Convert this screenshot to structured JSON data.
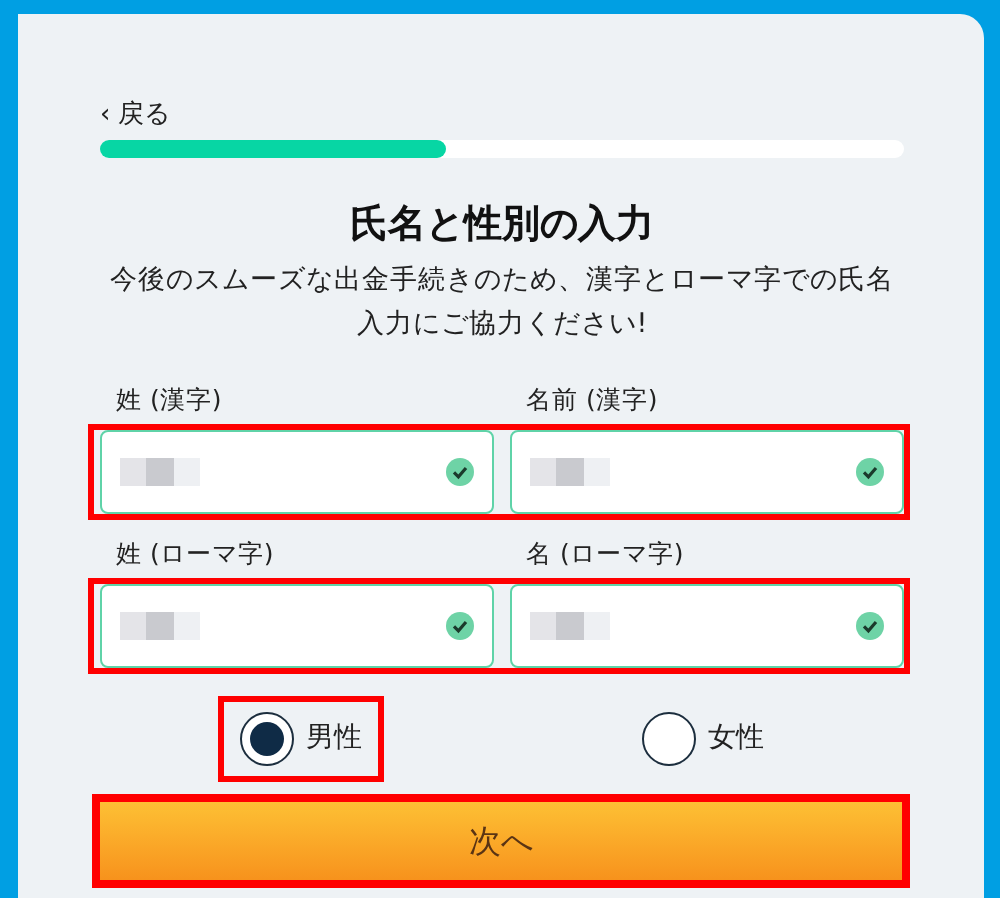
{
  "back_link": {
    "icon": "‹",
    "label": "戻る"
  },
  "progress": {
    "level": 0.43
  },
  "title": "氏名と性別の入力",
  "description": "今後のスムーズな出金手続きのため、漢字とローマ字での氏名入力にご協力ください!",
  "field_rows": [
    {
      "highlighted": true,
      "fields": [
        {
          "label": "姓 (漢字)",
          "redacted": true,
          "valid": true
        },
        {
          "label": "名前 (漢字)",
          "redacted": true,
          "valid": true
        }
      ]
    },
    {
      "highlighted": true,
      "fields": [
        {
          "label": "姓 (ローマ字)",
          "redacted": true,
          "valid": true
        },
        {
          "label": "名 (ローマ字)",
          "redacted": true,
          "valid": true
        }
      ]
    }
  ],
  "gender_options": [
    {
      "label": "男性",
      "selected": true,
      "highlighted": true
    },
    {
      "label": "女性",
      "selected": false,
      "highlighted": false
    }
  ],
  "next_button": {
    "label": "次へ",
    "highlighted": true
  }
}
